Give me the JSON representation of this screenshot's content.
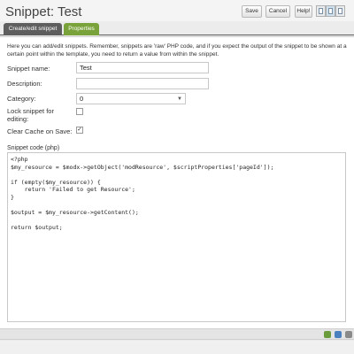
{
  "header": {
    "title": "Snippet: Test",
    "buttons": {
      "save": "Save",
      "cancel": "Cancel",
      "help": "Help!"
    }
  },
  "tabs": [
    {
      "label": "Create/edit snippet",
      "active": true
    },
    {
      "label": "Properties",
      "active": false
    }
  ],
  "intro": "Here you can add/edit snippets. Remember, snippets are 'raw' PHP code, and if you expect the output of the snippet to be shown at a certain point within the template, you need to return a value from within the snippet.",
  "form": {
    "name_label": "Snippet name:",
    "name_value": "Test",
    "description_label": "Description:",
    "description_value": "",
    "category_label": "Category:",
    "category_value": "0",
    "lock_label": "Lock snippet for editing:",
    "lock_checked": false,
    "cache_label": "Clear Cache on Save:",
    "cache_checked": true,
    "check_mark": "✓"
  },
  "code": {
    "label": "Snippet code (php)",
    "lines": [
      "<?php",
      "$my_resource = $modx->getObject('modResource', $scriptProperties['pageId']);",
      "",
      "if (empty($my_resource)) {",
      "    return 'Failed to get Resource';",
      "}",
      "",
      "$output = $my_resource->getContent();",
      "",
      "return $output;"
    ]
  },
  "colors": {
    "active_tab": "#5e5e5e",
    "properties_tab": "#79a33a"
  }
}
